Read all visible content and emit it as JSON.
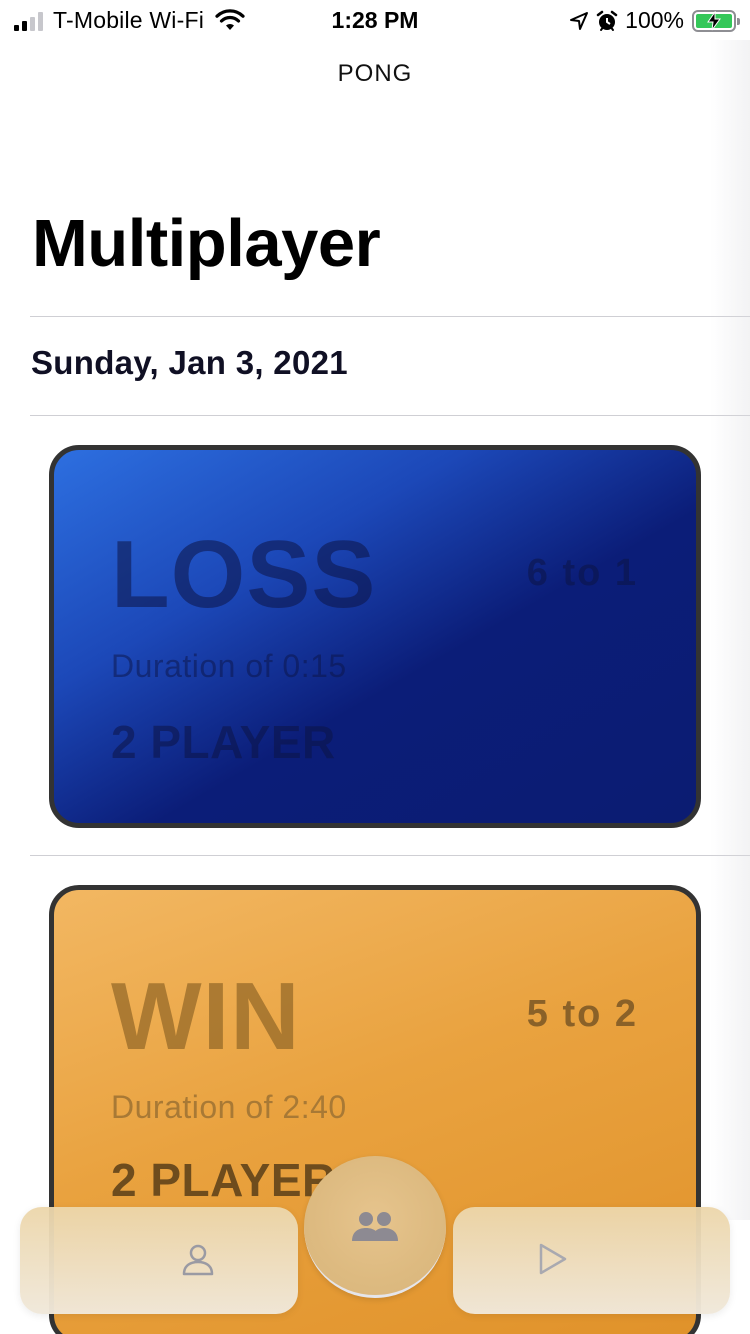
{
  "status_bar": {
    "carrier": "T-Mobile Wi-Fi",
    "time": "1:28 PM",
    "battery": "100%",
    "battery_level": 1.0,
    "icons": [
      "cellular-signal-icon",
      "wifi-icon",
      "location-arrow-icon",
      "alarm-clock-icon",
      "battery-charging-icon"
    ]
  },
  "header": {
    "app_name": "PONG",
    "title": "Multiplayer"
  },
  "sections": [
    {
      "date": "Sunday, Jan 3, 2021",
      "games": [
        {
          "result": "LOSS",
          "score": "6  to  1",
          "duration": "Duration of  0:15",
          "mode": "2 PLAYER",
          "color": "#0b1c72"
        },
        {
          "result": "WIN",
          "score": "5  to  2",
          "duration": "Duration of  2:40",
          "mode": "2 PLAYER",
          "color": "#e9a23f"
        }
      ]
    }
  ],
  "tab_bar": {
    "tabs": [
      {
        "name": "profile",
        "icon": "person-icon",
        "selected": false
      },
      {
        "name": "multiplayer",
        "icon": "people-icon",
        "selected": true
      },
      {
        "name": "play",
        "icon": "play-icon",
        "selected": false
      }
    ]
  }
}
